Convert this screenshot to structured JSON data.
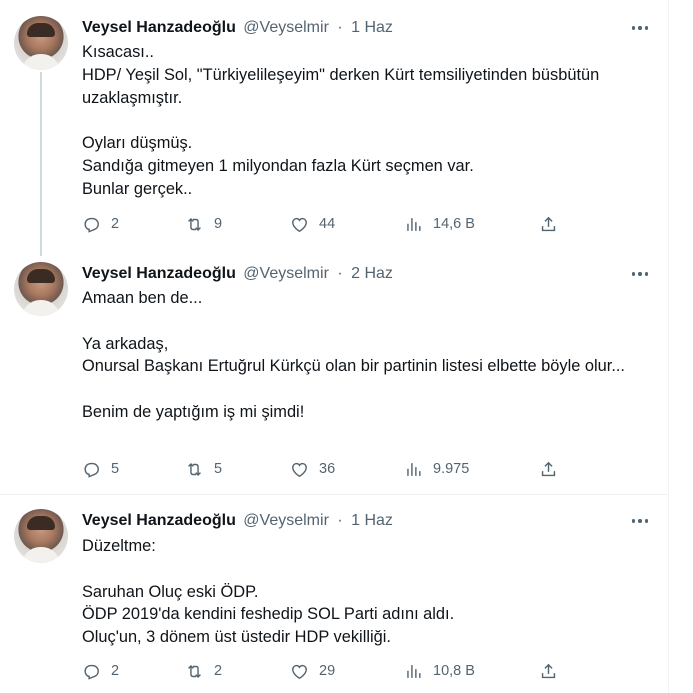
{
  "tweets": [
    {
      "name": "Veysel Hanzadeoğlu",
      "handle": "@Veyselmir",
      "dot": "·",
      "date": "1 Haz",
      "text": "Kısacası..\nHDP/ Yeşil Sol, \"Türkiyelileşeyim\" derken Kürt temsiliyetinden büsbütün uzaklaşmıştır.\n\nOyları düşmüş.\nSandığa gitmeyen 1 milyondan fazla Kürt seçmen var.\nBunlar gerçek..",
      "replies": "2",
      "retweets": "9",
      "likes": "44",
      "views": "14,6 B"
    },
    {
      "name": "Veysel Hanzadeoğlu",
      "handle": "@Veyselmir",
      "dot": "·",
      "date": "2 Haz",
      "text": "Amaan ben de...\n\nYa arkadaş,\nOnursal Başkanı Ertuğrul Kürkçü olan bir partinin listesi elbette böyle olur...\n\nBenim de yaptığım iş mi şimdi!",
      "replies": "5",
      "retweets": "5",
      "likes": "36",
      "views": "9.975"
    },
    {
      "name": "Veysel Hanzadeoğlu",
      "handle": "@Veyselmir",
      "dot": "·",
      "date": "1 Haz",
      "text": "Düzeltme:\n\nSaruhan Oluç eski ÖDP.\nÖDP 2019'da kendini feshedip SOL Parti adını aldı.\nOluç'un, 3 dönem üst üstedir HDP vekilliği.",
      "replies": "2",
      "retweets": "2",
      "likes": "29",
      "views": "10,8 B"
    }
  ],
  "icons": {
    "reply": "reply-icon",
    "retweet": "retweet-icon",
    "like": "like-icon",
    "views": "views-icon",
    "share": "share-icon",
    "more": "more-icon"
  },
  "colors": {
    "text": "#0f1419",
    "secondary": "#536471",
    "thread_line": "#cfd9de",
    "divider": "#eff3f4"
  }
}
